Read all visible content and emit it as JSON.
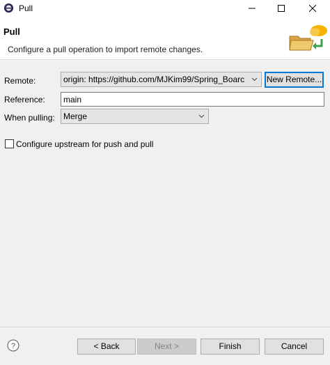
{
  "window": {
    "title": "Pull",
    "app_icon": "eclipse-icon",
    "controls": [
      "minimize-icon",
      "maximize-icon",
      "close-icon"
    ]
  },
  "header": {
    "title": "Pull",
    "description": "Configure a pull operation to import remote changes.",
    "banner_icon": "folder-pull-icon"
  },
  "form": {
    "remote_label": "Remote:",
    "remote_value": "origin: https://github.com/MJKim99/Spring_Boarc",
    "new_remote_label": "New Remote...",
    "reference_label": "Reference:",
    "reference_value": "main",
    "when_pulling_label": "When pulling:",
    "when_pulling_value": "Merge",
    "upstream_label": "Configure upstream for push and pull",
    "upstream_checked": false
  },
  "footer": {
    "back_label": "< Back",
    "next_label": "Next >",
    "finish_label": "Finish",
    "cancel_label": "Cancel"
  },
  "colors": {
    "focus_border": "#0078d7",
    "dialog_bg": "#f0f0f0",
    "header_bg": "#ffffff"
  }
}
